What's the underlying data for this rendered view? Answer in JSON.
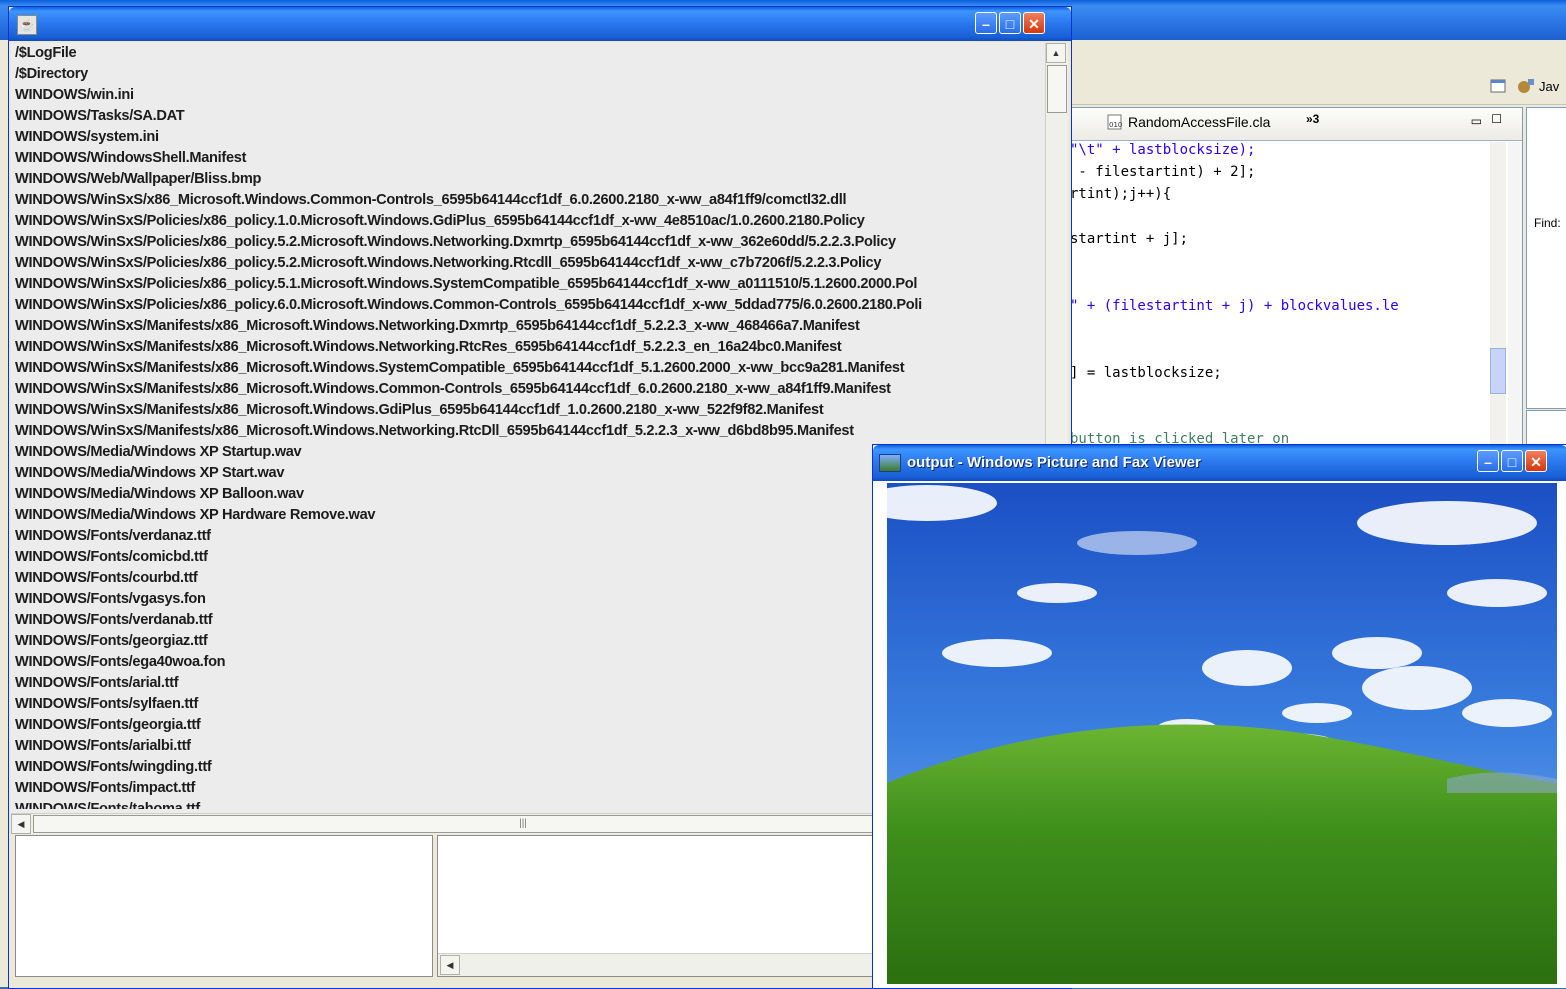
{
  "eclipse": {
    "perspective_label": "Jav",
    "editor_tab": "RandomAccessFile.cla",
    "tab_overflow": "»3",
    "find_label": "Find:",
    "code_lines": [
      "\"\\t\" + lastblocksize);",
      " - filestartint) + 2];",
      "rtint);j++){",
      "startint + j];",
      "\" + (filestartint + j) + blockvalues.le",
      "] = lastblocksize;",
      "button is clicked later on"
    ]
  },
  "filelist_window": {
    "title": "",
    "files": [
      "/$LogFile",
      "/$Directory",
      "WINDOWS/win.ini",
      "WINDOWS/Tasks/SA.DAT",
      "WINDOWS/system.ini",
      "WINDOWS/WindowsShell.Manifest",
      "WINDOWS/Web/Wallpaper/Bliss.bmp",
      "WINDOWS/WinSxS/x86_Microsoft.Windows.Common-Controls_6595b64144ccf1df_6.0.2600.2180_x-ww_a84f1ff9/comctl32.dll",
      "WINDOWS/WinSxS/Policies/x86_policy.1.0.Microsoft.Windows.GdiPlus_6595b64144ccf1df_x-ww_4e8510ac/1.0.2600.2180.Policy",
      "WINDOWS/WinSxS/Policies/x86_policy.5.2.Microsoft.Windows.Networking.Dxmrtp_6595b64144ccf1df_x-ww_362e60dd/5.2.2.3.Policy",
      "WINDOWS/WinSxS/Policies/x86_policy.5.2.Microsoft.Windows.Networking.Rtcdll_6595b64144ccf1df_x-ww_c7b7206f/5.2.2.3.Policy",
      "WINDOWS/WinSxS/Policies/x86_policy.5.1.Microsoft.Windows.SystemCompatible_6595b64144ccf1df_x-ww_a0111510/5.1.2600.2000.Pol",
      "WINDOWS/WinSxS/Policies/x86_policy.6.0.Microsoft.Windows.Common-Controls_6595b64144ccf1df_x-ww_5ddad775/6.0.2600.2180.Poli",
      "WINDOWS/WinSxS/Manifests/x86_Microsoft.Windows.Networking.Dxmrtp_6595b64144ccf1df_5.2.2.3_x-ww_468466a7.Manifest",
      "WINDOWS/WinSxS/Manifests/x86_Microsoft.Windows.Networking.RtcRes_6595b64144ccf1df_5.2.2.3_en_16a24bc0.Manifest",
      "WINDOWS/WinSxS/Manifests/x86_Microsoft.Windows.SystemCompatible_6595b64144ccf1df_5.1.2600.2000_x-ww_bcc9a281.Manifest",
      "WINDOWS/WinSxS/Manifests/x86_Microsoft.Windows.Common-Controls_6595b64144ccf1df_6.0.2600.2180_x-ww_a84f1ff9.Manifest",
      "WINDOWS/WinSxS/Manifests/x86_Microsoft.Windows.GdiPlus_6595b64144ccf1df_1.0.2600.2180_x-ww_522f9f82.Manifest",
      "WINDOWS/WinSxS/Manifests/x86_Microsoft.Windows.Networking.RtcDll_6595b64144ccf1df_5.2.2.3_x-ww_d6bd8b95.Manifest",
      "WINDOWS/Media/Windows XP Startup.wav",
      "WINDOWS/Media/Windows XP Start.wav",
      "WINDOWS/Media/Windows XP Balloon.wav",
      "WINDOWS/Media/Windows XP Hardware Remove.wav",
      "WINDOWS/Fonts/verdanaz.ttf",
      "WINDOWS/Fonts/comicbd.ttf",
      "WINDOWS/Fonts/courbd.ttf",
      "WINDOWS/Fonts/vgasys.fon",
      "WINDOWS/Fonts/verdanab.ttf",
      "WINDOWS/Fonts/georgiaz.ttf",
      "WINDOWS/Fonts/ega40woa.fon",
      "WINDOWS/Fonts/arial.ttf",
      "WINDOWS/Fonts/sylfaen.ttf",
      "WINDOWS/Fonts/georgia.ttf",
      "WINDOWS/Fonts/arialbi.ttf",
      "WINDOWS/Fonts/wingding.ttf",
      "WINDOWS/Fonts/impact.ttf",
      "WINDOWS/Fonts/tahoma.ttf"
    ]
  },
  "viewer_window": {
    "title": "output - Windows Picture and Fax Viewer"
  },
  "colors": {
    "titlebar_blue": "#2a76ec",
    "close_red": "#d4380d",
    "list_text": "#1c1c1c"
  }
}
